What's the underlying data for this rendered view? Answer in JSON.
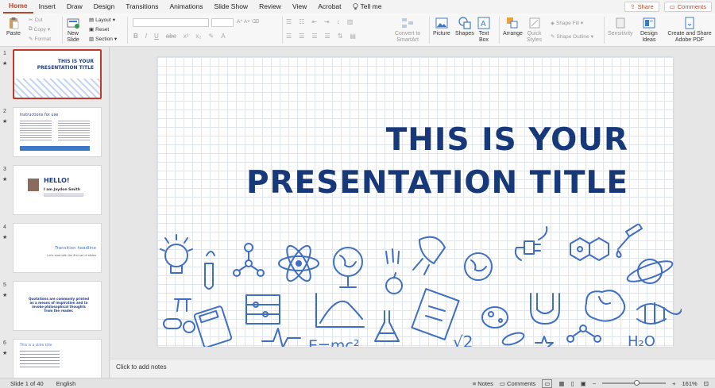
{
  "tabs": [
    "Home",
    "Insert",
    "Draw",
    "Design",
    "Transitions",
    "Animations",
    "Slide Show",
    "Review",
    "View",
    "Acrobat",
    "Tell me"
  ],
  "tab_actions": {
    "share": "Share",
    "comments": "Comments"
  },
  "ribbon": {
    "paste": "Paste",
    "cut": "Cut",
    "copy": "Copy",
    "format": "Format",
    "new_slide": "New\nSlide",
    "layout": "Layout",
    "reset": "Reset",
    "section": "Section",
    "convert": "Convert to\nSmartArt",
    "picture": "Picture",
    "shapes": "Shapes",
    "textbox": "Text\nBox",
    "arrange": "Arrange",
    "quick_styles": "Quick\nStyles",
    "shape_fill": "Shape Fill",
    "shape_outline": "Shape Outline",
    "sensitivity": "Sensitivity",
    "design_ideas": "Design\nIdeas",
    "adobe": "Create and Share\nAdobe PDF"
  },
  "thumbnails": [
    {
      "num": "1",
      "title": "THIS IS YOUR\nPRESENTATION TITLE"
    },
    {
      "num": "2",
      "title": "Instructions for use"
    },
    {
      "num": "3",
      "title": "HELLO!",
      "sub": "I am Jaydon Smith"
    },
    {
      "num": "4",
      "title": "Transition headline",
      "sub": "Let's start with the first set of slides"
    },
    {
      "num": "5",
      "title": "Quotations are commonly printed as a means of inspiration and to invoke philosophical thoughts from the reader."
    },
    {
      "num": "6",
      "title": "This is a slide title"
    }
  ],
  "slide": {
    "title_line1": "THIS IS YOUR",
    "title_line2": "PRESENTATION TITLE",
    "formula": "E=mc²",
    "sqrt": "√2",
    "h2o": "H₂O"
  },
  "notes_placeholder": "Click to add notes",
  "status": {
    "slide_of": "Slide 1 of 40",
    "language": "English",
    "notes": "Notes",
    "comments": "Comments",
    "zoom": "161%"
  },
  "colors": {
    "accent": "#b7472a",
    "doodle": "#3f6fc2",
    "title": "#17397a"
  }
}
